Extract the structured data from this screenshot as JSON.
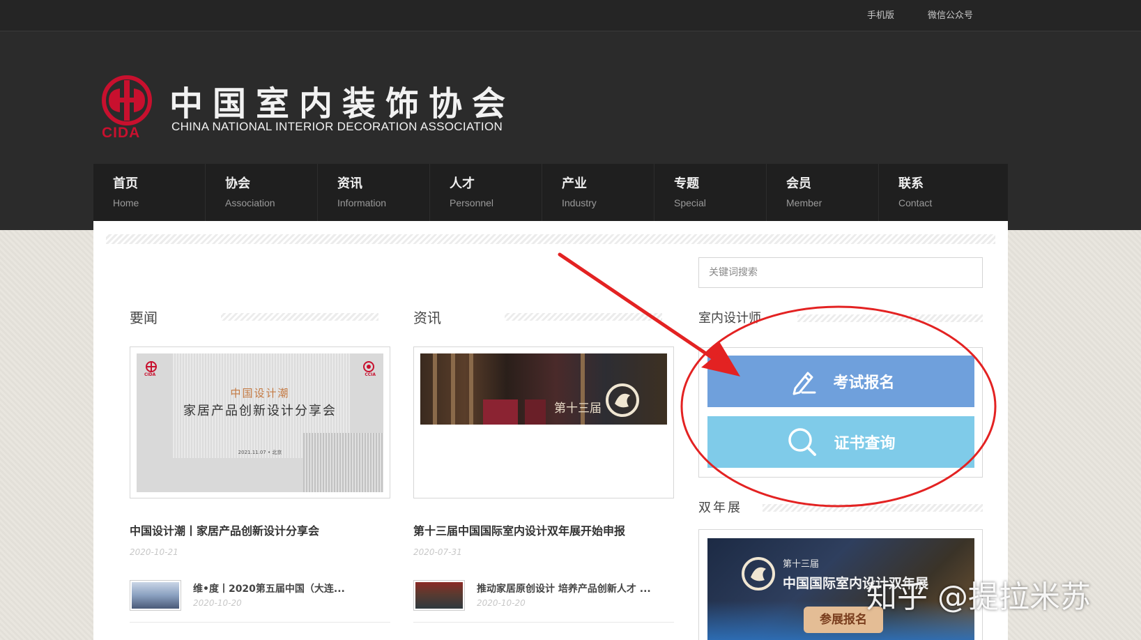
{
  "topbar": {
    "mobile": "手机版",
    "wechat": "微信公众号"
  },
  "logo": {
    "abbr": "CIDA",
    "cn": "中国室内装饰协会",
    "en": "CHINA NATIONAL INTERIOR DECORATION ASSOCIATION",
    "color": "#c8102e"
  },
  "nav": [
    {
      "cn": "首页",
      "en": "Home"
    },
    {
      "cn": "协会",
      "en": "Association"
    },
    {
      "cn": "资讯",
      "en": "Information"
    },
    {
      "cn": "人才",
      "en": "Personnel"
    },
    {
      "cn": "产业",
      "en": "Industry"
    },
    {
      "cn": "专题",
      "en": "Special"
    },
    {
      "cn": "会员",
      "en": "Member"
    },
    {
      "cn": "联系",
      "en": "Contact"
    }
  ],
  "search": {
    "placeholder": "关键词搜索"
  },
  "news": {
    "title": "要闻",
    "feature": {
      "image_small_logo_left": "CIDA",
      "image_small_logo_right": "CCIA",
      "image_line1": "中国设计潮",
      "image_line2": "家居产品创新设计分享会",
      "image_line3": "2021.11.07 • 北京",
      "headline": "中国设计潮丨家居产品创新设计分享会",
      "date": "2020-10-21"
    },
    "items": [
      {
        "title": "维•度丨2020第五届中国（大连...",
        "date": "2020-10-20"
      }
    ]
  },
  "info": {
    "title": "资讯",
    "feature": {
      "image_label": "第十三届",
      "headline": "第十三届中国国际室内设计双年展开始申报",
      "date": "2020-07-31"
    },
    "items": [
      {
        "title": "推动家居原创设计 培养产品创新人才 ...",
        "date": "2020-10-20"
      }
    ]
  },
  "designer": {
    "title": "室内设计师",
    "exam_button": "考试报名",
    "cert_button": "证书查询",
    "exam_color": "#6fa0dc",
    "cert_color": "#7fcbe9"
  },
  "biennale": {
    "title": "双年展",
    "banner_line1": "第十三届",
    "banner_line2": "中国国际室内设计双年展",
    "register_button": "参展报名"
  },
  "annotation": {
    "arrow_color": "#e32222",
    "circle_color": "#e32222"
  },
  "watermark": "知乎 @提拉米苏"
}
